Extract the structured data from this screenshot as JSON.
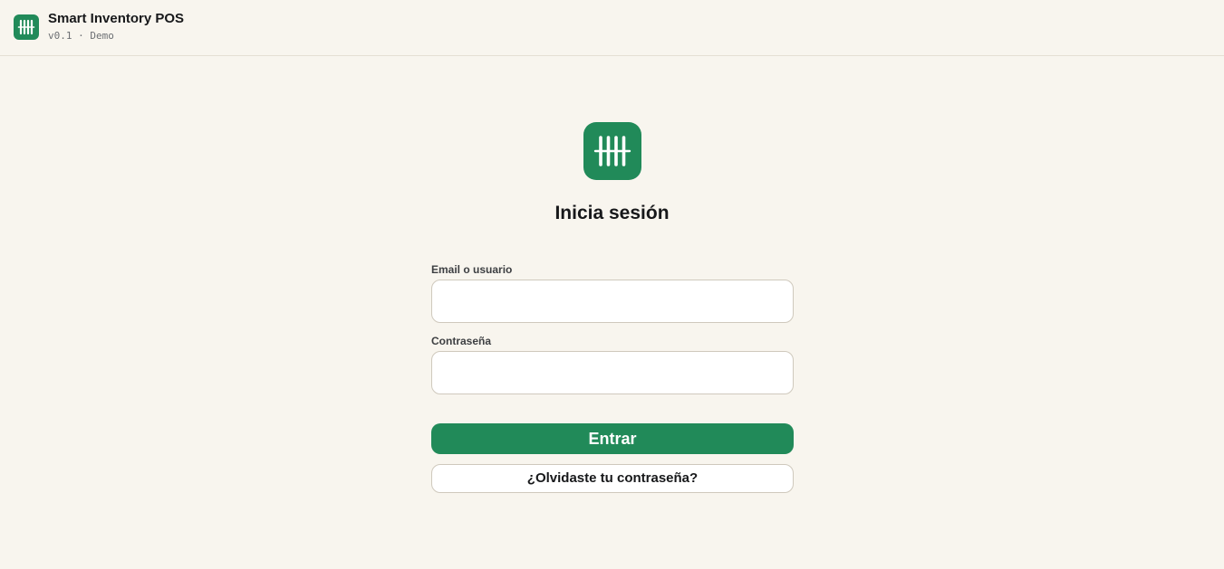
{
  "header": {
    "app_title": "Smart Inventory POS",
    "version": "v0.1 · Demo",
    "logo_icon": "barcode-icon"
  },
  "login": {
    "logo_icon": "barcode-icon",
    "title": "Inicia sesión",
    "email_label": "Email o usuario",
    "email_value": "",
    "password_label": "Contraseña",
    "password_value": "",
    "submit_label": "Entrar",
    "forgot_label": "¿Olvidaste tu contraseña?"
  },
  "colors": {
    "accent": "#218a59",
    "background": "#f8f5ee",
    "input_border": "#cfc9bd",
    "text": "#17181a"
  }
}
